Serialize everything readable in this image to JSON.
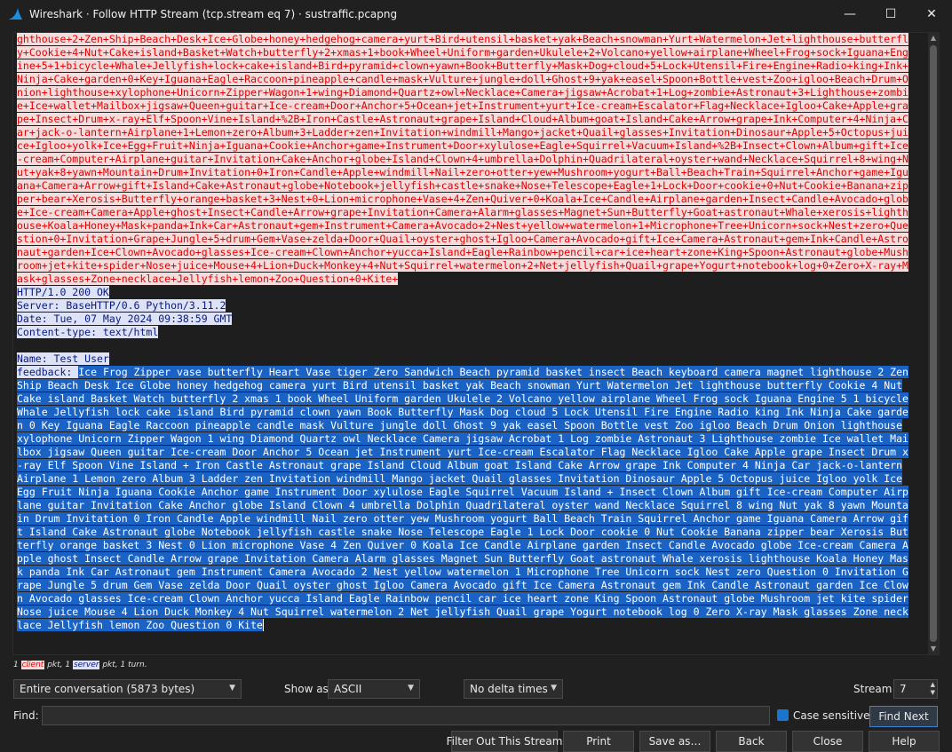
{
  "window": {
    "title": "Wireshark · Follow HTTP Stream (tcp.stream eq 7) · sustraffic.pcapng",
    "minimize": "—",
    "maximize": "☐",
    "close": "✕"
  },
  "stream": {
    "client_lines": [
      "ghthouse+2+Zen+Ship+Beach+Desk+Ice+Globe+honey+hedgehog+camera+yurt+Bird+utensil+basket+yak+Beach+snowman+Yurt+Watermelon+Jet+lighthouse+butterfl",
      "y+Cookie+4+Nut+Cake+island+Basket+Watch+butterfly+2+xmas+1+book+Wheel+Uniform+garden+Ukulele+2+Volcano+yellow+airplane+Wheel+Frog+sock+Iguana+Eng",
      "ine+5+1+bicycle+Whale+Jellyfish+lock+cake+island+Bird+pyramid+clown+yawn+Book+Butterfly+Mask+Dog+cloud+5+Lock+Utensil+Fire+Engine+Radio+king+Ink+",
      "Ninja+Cake+garden+0+Key+Iguana+Eagle+Raccoon+pineapple+candle+mask+Vulture+jungle+doll+Ghost+9+yak+easel+Spoon+Bottle+vest+Zoo+igloo+Beach+Drum+O",
      "nion+lighthouse+xylophone+Unicorn+Zipper+Wagon+1+wing+Diamond+Quartz+owl+Necklace+Camera+jigsaw+Acrobat+1+Log+zombie+Astronaut+3+Lighthouse+zombi",
      "e+Ice+wallet+Mailbox+jigsaw+Queen+guitar+Ice-cream+Door+Anchor+5+Ocean+jet+Instrument+yurt+Ice-cream+Escalator+Flag+Necklace+Igloo+Cake+Apple+gra",
      "pe+Insect+Drum+x-ray+Elf+Spoon+Vine+Island+%2B+Iron+Castle+Astronaut+grape+Island+Cloud+Album+goat+Island+Cake+Arrow+grape+Ink+Computer+4+Ninja+C",
      "ar+jack-o-lantern+Airplane+1+Lemon+zero+Album+3+Ladder+zen+Invitation+windmill+Mango+jacket+Quail+glasses+Invitation+Dinosaur+Apple+5+Octopus+jui",
      "ce+Igloo+yolk+Ice+Egg+Fruit+Ninja+Iguana+Cookie+Anchor+game+Instrument+Door+xylulose+Eagle+Squirrel+Vacuum+Island+%2B+Insect+Clown+Album+gift+Ice",
      "-cream+Computer+Airplane+guitar+Invitation+Cake+Anchor+globe+Island+Clown+4+umbrella+Dolphin+Quadrilateral+oyster+wand+Necklace+Squirrel+8+wing+N",
      "ut+yak+8+yawn+Mountain+Drum+Invitation+0+Iron+Candle+Apple+windmill+Nail+zero+otter+yew+Mushroom+yogurt+Ball+Beach+Train+Squirrel+Anchor+game+Igu",
      "ana+Camera+Arrow+gift+Island+Cake+Astronaut+globe+Notebook+jellyfish+castle+snake+Nose+Telescope+Eagle+1+Lock+Door+cookie+0+Nut+Cookie+Banana+zip",
      "per+bear+Xerosis+Butterfly+orange+basket+3+Nest+0+Lion+microphone+Vase+4+Zen+Quiver+0+Koala+Ice+Candle+Airplane+garden+Insect+Candle+Avocado+glob",
      "e+Ice-cream+Camera+Apple+ghost+Insect+Candle+Arrow+grape+Invitation+Camera+Alarm+glasses+Magnet+Sun+Butterfly+Goat+astronaut+Whale+xerosis+lighth",
      "ouse+Koala+Honey+Mask+panda+Ink+Car+Astronaut+gem+Instrument+Camera+Avocado+2+Nest+yellow+watermelon+1+Microphone+Tree+Unicorn+sock+Nest+zero+Que",
      "stion+0+Invitation+Grape+Jungle+5+drum+Gem+Vase+zelda+Door+Quail+oyster+ghost+Igloo+Camera+Avocado+gift+Ice+Camera+Astronaut+gem+Ink+Candle+Astro",
      "naut+garden+Ice+Clown+Avocado+glasses+Ice-cream+Clown+Anchor+yucca+Island+Eagle+Rainbow+pencil+car+ice+heart+zone+King+Spoon+Astronaut+globe+Mush",
      "room+jet+kite+spider+Nose+juice+Mouse+4+Lion+Duck+Monkey+4+Nut+Squirrel+watermelon+2+Net+jellyfish+Quail+grape+Yogurt+notebook+log+0+Zero+X-ray+M",
      "ask+glasses+Zone+necklace+Jellyfish+lemon+Zoo+Question+0+Kite+"
    ],
    "server_lines": [
      "HTTP/1.0 200 OK",
      "Server: BaseHTTP/0.6 Python/3.11.2",
      "Date: Tue, 07 May 2024 09:38:59 GMT",
      "Content-type: text/html",
      "",
      "Name: Test User"
    ],
    "feedback_label": "feedback: ",
    "feedback_first_line": "Ice Frog Zipper vase butterfly Heart Vase tiger Zero Sandwich Beach pyramid basket insect Beach keyboard camera magnet lighthouse 2 Zen",
    "selected_lines": [
      "Ship Beach Desk Ice Globe honey hedgehog camera yurt Bird utensil basket yak Beach snowman Yurt Watermelon Jet lighthouse butterfly Cookie 4 Nut",
      "Cake island Basket Watch butterfly 2 xmas 1 book Wheel Uniform garden Ukulele 2 Volcano yellow airplane Wheel Frog sock Iguana Engine 5 1 bicycle",
      "Whale Jellyfish lock cake island Bird pyramid clown yawn Book Butterfly Mask Dog cloud 5 Lock Utensil Fire Engine Radio king Ink Ninja Cake garde",
      "n 0 Key Iguana Eagle Raccoon pineapple candle mask Vulture jungle doll Ghost 9 yak easel Spoon Bottle vest Zoo igloo Beach Drum Onion lighthouse",
      "xylophone Unicorn Zipper Wagon 1 wing Diamond Quartz owl Necklace Camera jigsaw Acrobat 1 Log zombie Astronaut 3 Lighthouse zombie Ice wallet Mai",
      "lbox jigsaw Queen guitar Ice-cream Door Anchor 5 Ocean jet Instrument yurt Ice-cream Escalator Flag Necklace Igloo Cake Apple grape Insect Drum x",
      "-ray Elf Spoon Vine Island + Iron Castle Astronaut grape Island Cloud Album goat Island Cake Arrow grape Ink Computer 4 Ninja Car jack-o-lantern",
      "Airplane 1 Lemon zero Album 3 Ladder zen Invitation windmill Mango jacket Quail glasses Invitation Dinosaur Apple 5 Octopus juice Igloo yolk Ice",
      "Egg Fruit Ninja Iguana Cookie Anchor game Instrument Door xylulose Eagle Squirrel Vacuum Island + Insect Clown Album gift Ice-cream Computer Airp",
      "lane guitar Invitation Cake Anchor globe Island Clown 4 umbrella Dolphin Quadrilateral oyster wand Necklace Squirrel 8 wing Nut yak 8 yawn Mounta",
      "in Drum Invitation 0 Iron Candle Apple windmill Nail zero otter yew Mushroom yogurt Ball Beach Train Squirrel Anchor game Iguana Camera Arrow gif",
      "t Island Cake Astronaut globe Notebook jellyfish castle snake Nose Telescope Eagle 1 Lock Door cookie 0 Nut Cookie Banana zipper bear Xerosis But",
      "terfly orange basket 3 Nest 0 Lion microphone Vase 4 Zen Quiver 0 Koala Ice Candle Airplane garden Insect Candle Avocado globe Ice-cream Camera A",
      "pple ghost Insect Candle Arrow grape Invitation Camera Alarm glasses Magnet Sun Butterfly Goat astronaut Whale xerosis lighthouse Koala Honey Mas",
      "k panda Ink Car Astronaut gem Instrument Camera Avocado 2 Nest yellow watermelon 1 Microphone Tree Unicorn sock Nest zero Question 0 Invitation G",
      "rape Jungle 5 drum Gem Vase zelda Door Quail oyster ghost Igloo Camera Avocado gift Ice Camera Astronaut gem Ink Candle Astronaut garden Ice Clow",
      "n Avocado glasses Ice-cream Clown Anchor yucca Island Eagle Rainbow pencil car ice heart zone King Spoon Astronaut globe Mushroom jet kite spider",
      "Nose juice Mouse 4 Lion Duck Monkey 4 Nut Squirrel watermelon 2 Net jellyfish Quail grape Yogurt notebook log 0 Zero X-ray Mask glasses Zone neck",
      "lace Jellyfish lemon Zoo Question 0 Kite"
    ]
  },
  "packet_info": {
    "prefix": "1 ",
    "client_tag": "client",
    "middle": " pkt, 1 ",
    "server_tag": "server",
    "suffix": " pkt, 1 turn."
  },
  "controls": {
    "conversation": "Entire conversation (5873 bytes)",
    "show_as_label": "Show as",
    "show_as_value": "ASCII",
    "delta": "No delta times",
    "stream_label": "Stream",
    "stream_value": "7",
    "find_label": "Find:",
    "find_value": "",
    "case_sensitive": "Case sensitive",
    "find_next": "Find Next"
  },
  "buttons": {
    "filter_out": "Filter Out This Stream",
    "print": "Print",
    "save_as": "Save as…",
    "back": "Back",
    "close": "Close",
    "help": "Help"
  },
  "colors": {
    "client_fg": "#e00000",
    "client_bg": "#f4dcdc",
    "server_fg": "#0a1a7a",
    "server_bg": "#dde2f6",
    "selection_bg": "#1a63c5"
  }
}
